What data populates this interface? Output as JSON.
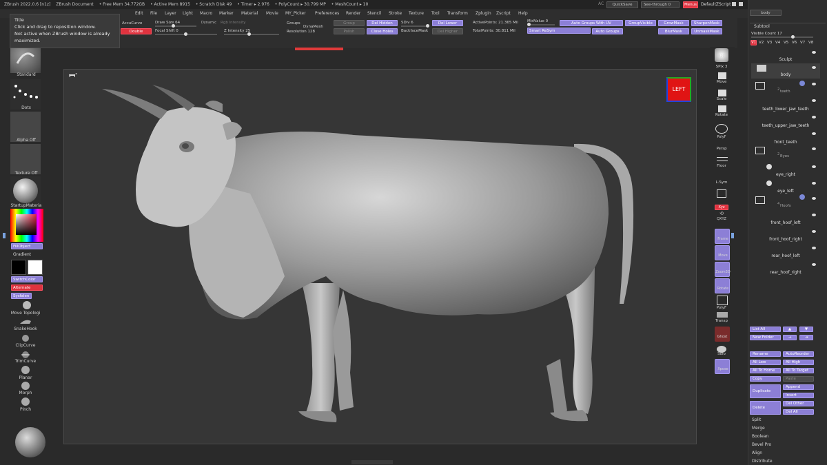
{
  "title_bar": {
    "app": "ZBrush 2022.0.6 [n1z]",
    "doc": "ZBrush Document",
    "free_mem": "• Free Mem 34.772GB",
    "active_mem": "• Active Mem 8915",
    "scratch": "• Scratch Disk 49",
    "timer": "• Timer ▸ 2.976",
    "polycount": "• PolyCount ▸ 30.799 MP",
    "meshcount": "• MeshCount ▸ 10",
    "ac": "AC",
    "quicksave": "QuickSave",
    "seethrough": "See-through",
    "seethrough_val": "0",
    "menus_btn": "Menus",
    "defaultscript": "DefaultZScript"
  },
  "menus": [
    "Edit",
    "File",
    "Layer",
    "Light",
    "Macro",
    "Marker",
    "Material",
    "Movie",
    "MY_Picker",
    "Preferences",
    "Render",
    "Stencil",
    "Stroke",
    "Texture",
    "Tool",
    "Transform",
    "Zplugin",
    "Zscript",
    "Help"
  ],
  "tooltip": {
    "title": "Title",
    "line1": "Click and drag to reposition window.",
    "line2": "Not active when ZBrush window is already",
    "line3": "maximized."
  },
  "topbar": {
    "accucurve": "AccuCurve",
    "double": "Double",
    "draw_size": "Draw Size",
    "draw_size_val": "64",
    "dynamic": "Dynamic",
    "focal_shift": "Focal Shift",
    "focal_shift_val": "0",
    "rgb_intensity": "Rgb Intensity",
    "z_intensity": "Z Intensity",
    "z_intensity_val": "25",
    "groups": "Groups",
    "dynamesh": "DynaMesh",
    "resolution": "Resolution",
    "resolution_val": "128",
    "group": "Group",
    "polish": "Polish",
    "del_hidden": "Del Hidden",
    "close_holes": "Close Holes",
    "sdiv": "SDiv",
    "sdiv_val": "6",
    "backfacemask": "BackfaceMask",
    "del_lower": "Del Lower",
    "del_higher": "Del Higher",
    "active_points": "ActivePoints:",
    "active_points_val": "21.365 Mil",
    "total_points": "TotalPoints:",
    "total_points_val": "30.811 Mil",
    "midvalue": "MidValue",
    "midvalue_val": "0",
    "smart_resym": "Smart ReSym",
    "auto_groups_uv": "Auto Groups With UV",
    "auto_groups": "Auto Groups",
    "group_visible": "GroupVisible",
    "grow_mask": "GrowMask",
    "blur_mask": "BlurMask",
    "sharpen_mask": "SharpenMask",
    "unmask": "UnmaskMask"
  },
  "left": {
    "brush": "Standard",
    "stroke": "Dots",
    "alpha": "Alpha Off",
    "texture": "Texture Off",
    "material": "StartupMateria",
    "fill_object": "FillObject",
    "gradient": "Gradient",
    "switch_color": "SwitchColor",
    "alternate": "Alternate",
    "sysfalen": "Sysfalen",
    "tools": [
      "Move Topologi",
      "SnakeHook",
      "ClipCurve",
      "TrimCurve",
      "Planar",
      "Morph",
      "Pinch"
    ]
  },
  "shelf": [
    "SPix 3",
    "Move",
    "Scale",
    "Rotate",
    "PolyF",
    "Persp",
    "Floor",
    "L.Sym",
    "Xyz",
    "Frame",
    "Move",
    "Zoom3D",
    "Rotate",
    "PolyF",
    "Transp",
    "Ghost",
    "Solo",
    "Xpose"
  ],
  "shelf_extra": {
    "bpr": "BPR",
    "qxyz": "QXYZ"
  },
  "orientation_label": "LEFT",
  "right": {
    "body_tab": "body",
    "subtool": "Subtool",
    "visible_count": "Visible Count",
    "visible_count_val": "17",
    "versions": [
      "V1",
      "V2",
      "V3",
      "V4",
      "V5",
      "V6",
      "V7",
      "V8"
    ],
    "items": [
      {
        "name": "Sculpt"
      },
      {
        "name": "body"
      },
      {
        "name": "teeth",
        "folder": true
      },
      {
        "name": "teeth_lower_jaw_teeth"
      },
      {
        "name": "teeth_upper_jaw_teeth"
      },
      {
        "name": "front_teeth"
      },
      {
        "name": "Eyes",
        "folder": true
      },
      {
        "name": "eye_right"
      },
      {
        "name": "eye_left"
      },
      {
        "name": "Hoofs",
        "folder": true
      },
      {
        "name": "front_hoof_left"
      },
      {
        "name": "front_hoof_right"
      },
      {
        "name": "rear_hoof_left"
      },
      {
        "name": "rear_hoof_right"
      }
    ],
    "folder_numbers": {
      "teeth": "2",
      "eyes": "2",
      "hoofs": "4"
    },
    "list_all": "List All",
    "new_folder": "New Folder",
    "rename": "Rename",
    "auto_reorder": "AutoReorder",
    "all_low": "All Low",
    "all_high": "All High",
    "all_to_home": "All To Home",
    "all_to_target": "All To Target",
    "copy": "Copy",
    "paste": "Paste",
    "duplicate": "Duplicate",
    "append": "Append",
    "insert": "Insert",
    "delete": "Delete",
    "del_other": "Del Other",
    "del_all": "Del All",
    "split": "Split",
    "merge": "Merge",
    "boolean": "Boolean",
    "bevel_pro": "Bevel Pro",
    "align": "Align",
    "distribute": "Distribute"
  }
}
